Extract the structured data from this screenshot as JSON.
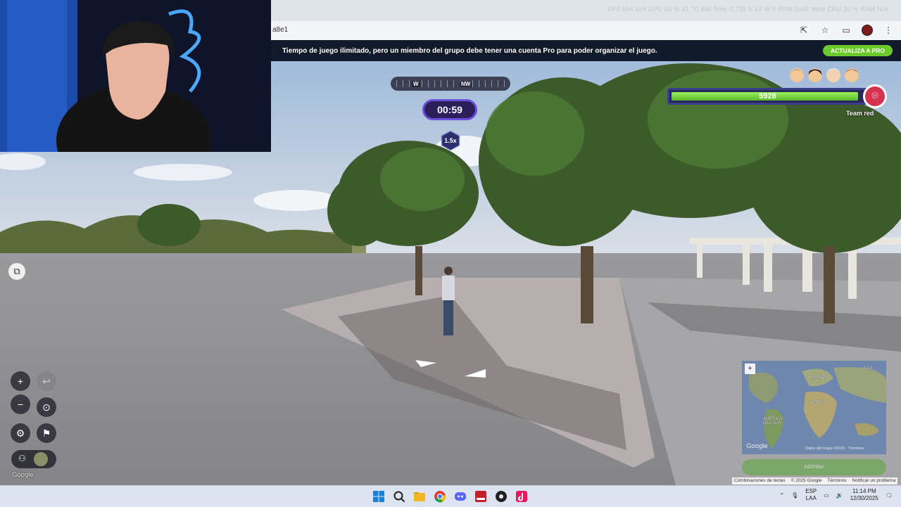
{
  "browser": {
    "address": "a8e1",
    "performance_overlay": "FPS N/A N/A   GPU 25 % 41 °C 885 MHz 0.725 V 44 W 0 RPM 5001 MHz   CPU 20 %   RAM N/A",
    "toolbar_icons": [
      "install-icon",
      "star-icon",
      "tab-search-icon",
      "profile-avatar",
      "menu-kebab-icon"
    ]
  },
  "pro_banner": {
    "message": "Tiempo de juego ilimitado, pero un miembro del grupo debe tener una cuenta Pro para poder organizar el juego.",
    "button": "ACTUALIZA A PRO",
    "accent": "#6cc92a"
  },
  "hud": {
    "compass_labels": [
      "W",
      "NW"
    ],
    "timer": "00:59",
    "speed": "1.5x",
    "team": {
      "score": "5928",
      "health_fraction": 0.97,
      "name": "Team red",
      "bar_color": "#7fdc45",
      "pin_color": "#d4324f",
      "member_count": 4
    }
  },
  "left_controls": {
    "zoom_in": "+",
    "zoom_out": "−",
    "undo": "↩",
    "checkpoint": "⊙",
    "settings": "⚙",
    "flag": "⚑",
    "google": "Google"
  },
  "minimap": {
    "labels": {
      "europe": "EUROPA",
      "africa": "ÁFRICA",
      "south_america": "AMÉRICA DEL SUR",
      "asia": "ASIA"
    },
    "google": "Google",
    "data_credit": "Datos del mapa ©2025",
    "terms": "Términos",
    "zoom": "+",
    "guess_button": "ADIVINA"
  },
  "attribution": {
    "shortcuts": "Combinaciones de teclas",
    "copyright": "© 2025 Google",
    "terms": "Términos",
    "report": "Notificar un problema"
  },
  "taskbar": {
    "apps": [
      "windows-start-icon",
      "search-icon",
      "file-explorer-icon",
      "chrome-icon",
      "discord-icon",
      "voicemod-icon",
      "obs-icon",
      "tiktok-icon"
    ],
    "language": "ESP",
    "layout": "LAA",
    "time": "11:14 PM",
    "date": "12/30/2025"
  }
}
